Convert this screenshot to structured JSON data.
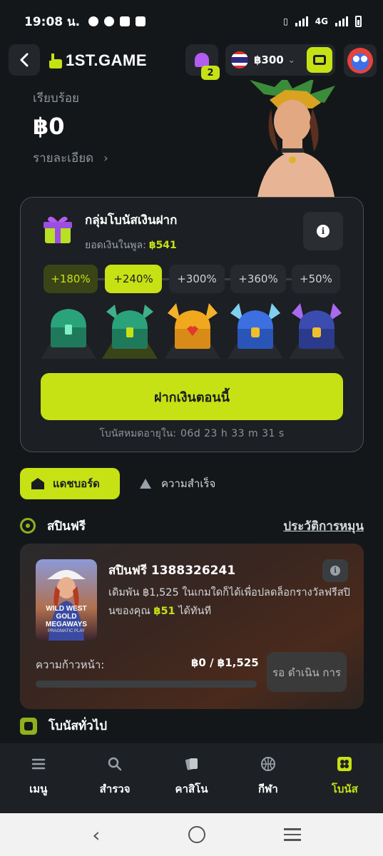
{
  "status_bar": {
    "time": "19:08 น.",
    "network": "4G"
  },
  "header": {
    "logo_text": "1ST.GAME",
    "notification_count": "2",
    "balance": "฿300"
  },
  "hero": {
    "label": "เรียบร้อย",
    "amount": "฿0",
    "details_link": "รายละเอียด"
  },
  "deposit_pool": {
    "title": "กลุ่มโบนัสเงินฝาก",
    "pool_label": "ยอดเงินในพูล:",
    "pool_value": "฿541",
    "tiers": [
      "+180%",
      "+240%",
      "+300%",
      "+360%",
      "+50%"
    ],
    "tier_states": [
      "done",
      "current",
      "locked",
      "locked",
      "locked"
    ],
    "deposit_button": "ฝากเงินตอนนี้",
    "expiry_label": "โบนัสหมดอายุใน:",
    "expiry_time": "06d 23 h 33 m 31  s"
  },
  "tabs": {
    "dashboard": "แดชบอร์ด",
    "achievements": "ความสำเร็จ"
  },
  "free_spins": {
    "section_title": "สปินฟรี",
    "history_link": "ประวัติการหมุน",
    "card": {
      "thumb_title": "WILD WEST GOLD MEGAWAYS",
      "thumb_brand": "PRAGMATIC PLAY",
      "title": "สปินฟรี 1388326241",
      "desc_prefix": "เดิมพัน ฿1,525 ในเกมใดก็ได้เพื่อปลดล็อกรางวัลฟรีสปินของคุณ ",
      "desc_highlight": "฿51",
      "desc_suffix": " ได้ทันที",
      "progress_label": "ความก้าวหน้า:",
      "progress_value": "฿0 / ฿1,525",
      "progress_fraction": 0,
      "pending_button": "รอ ดำเนิน การ"
    }
  },
  "general_bonus": {
    "title": "โบนัสทั่วไป"
  },
  "bottom_nav": {
    "menu": "เมนู",
    "explore": "สำรวจ",
    "casino": "คาสิโน",
    "sports": "กีฬา",
    "bonus": "โบนัส"
  },
  "colors": {
    "accent": "#c6e214",
    "background": "#14171a",
    "card": "#1c1f23"
  }
}
